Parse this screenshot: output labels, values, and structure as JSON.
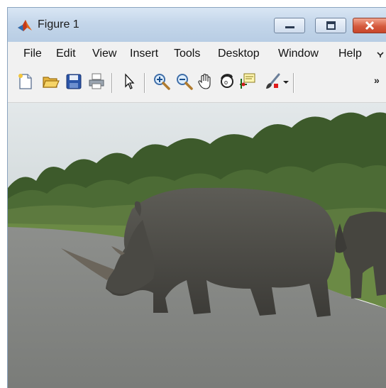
{
  "window": {
    "title": "Figure 1",
    "app_icon": "matlab-icon",
    "controls": [
      "minimize-icon",
      "maximize-icon",
      "close-icon"
    ]
  },
  "menubar": {
    "items": [
      {
        "label": "File"
      },
      {
        "label": "Edit"
      },
      {
        "label": "View"
      },
      {
        "label": "Insert"
      },
      {
        "label": "Tools"
      },
      {
        "label": "Desktop"
      },
      {
        "label": "Window"
      },
      {
        "label": "Help"
      }
    ],
    "overflow_icon": "chevron-overflow-icon"
  },
  "toolbar": {
    "tools": [
      {
        "icon": "new-figure-icon"
      },
      {
        "icon": "open-file-icon"
      },
      {
        "icon": "save-icon"
      },
      {
        "icon": "print-icon"
      },
      {
        "icon": "select-arrow-icon"
      },
      {
        "icon": "zoom-in-icon"
      },
      {
        "icon": "zoom-out-icon"
      },
      {
        "icon": "pan-hand-icon"
      },
      {
        "icon": "rotate-3d-icon"
      },
      {
        "icon": "data-cursor-icon"
      },
      {
        "icon": "brush-icon"
      },
      {
        "icon": "dropdown-arrow-icon"
      }
    ],
    "overflow_label": "»"
  },
  "figure": {
    "content": "photo"
  }
}
